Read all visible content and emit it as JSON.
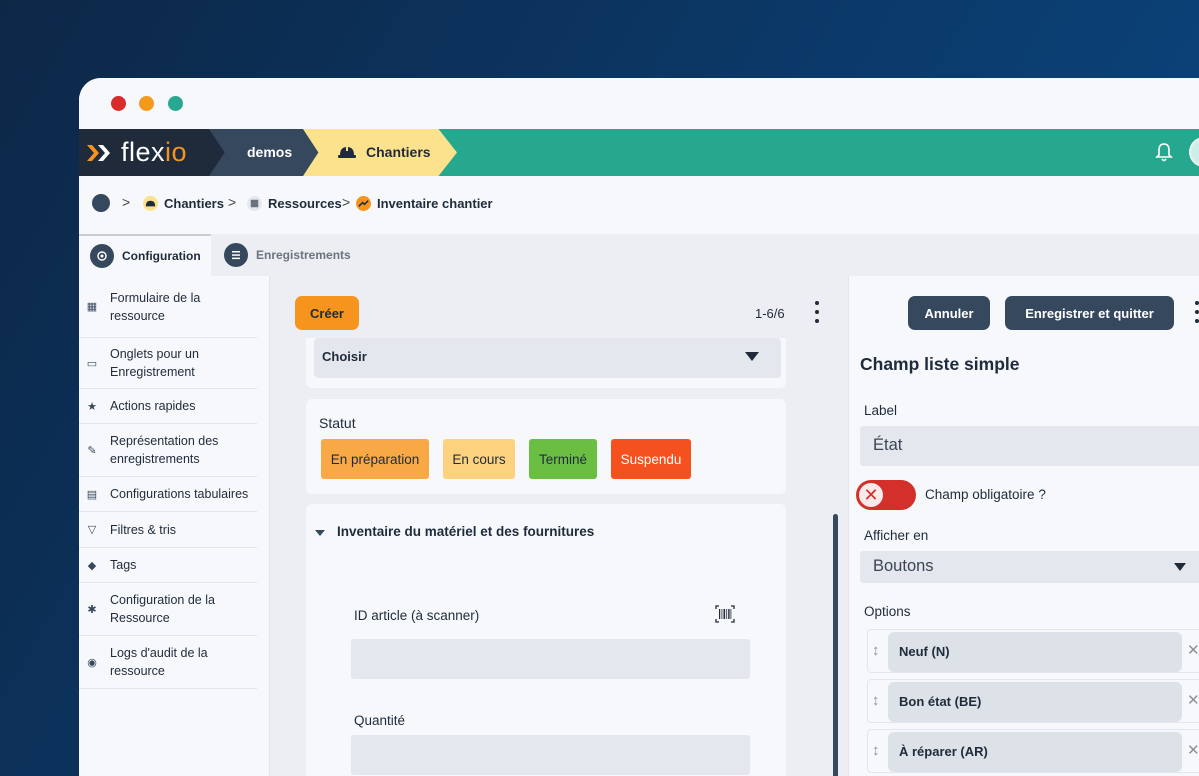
{
  "window_controls": [
    "close",
    "minimize",
    "maximize"
  ],
  "topbar": {
    "logo_text_main": "flex",
    "logo_text_accent": "io",
    "workspace": "demos",
    "app": "Chantiers",
    "colors": {
      "bar": "#25a88e",
      "logo_bg": "#1f2b3b",
      "workspace_bg": "#36485e",
      "app_bg": "#fce28c",
      "accent": "#f7941e"
    }
  },
  "breadcrumb": {
    "items": [
      "Chantiers",
      "Ressources",
      "Inventaire chantier"
    ],
    "separator": ">"
  },
  "tabs": [
    {
      "label": "Configuration",
      "icon": "gear-icon",
      "active": true
    },
    {
      "label": "Enregistrements",
      "icon": "list-icon",
      "active": false
    }
  ],
  "sidebar": {
    "items": [
      {
        "icon": "table-icon",
        "glyph": "▦",
        "label": "Formulaire de la ressource"
      },
      {
        "icon": "folder-icon",
        "glyph": "▭",
        "label": "Onglets pour un Enregistrement"
      },
      {
        "icon": "star-icon",
        "glyph": "★",
        "label": "Actions rapides"
      },
      {
        "icon": "pencil-icon",
        "glyph": "✎",
        "label": "Représentation des enregistrements"
      },
      {
        "icon": "document-icon",
        "glyph": "▤",
        "label": "Configurations tabulaires"
      },
      {
        "icon": "filter-icon",
        "glyph": "▽",
        "label": "Filtres & tris"
      },
      {
        "icon": "tag-icon",
        "glyph": "◆",
        "label": "Tags"
      },
      {
        "icon": "gear-icon",
        "glyph": "✱",
        "label": "Configuration de la Ressource"
      },
      {
        "icon": "eye-icon",
        "glyph": "◉",
        "label": "Logs d'audit de la ressource"
      }
    ]
  },
  "center": {
    "create_label": "Créer",
    "pager": "1-6/6",
    "select_value": "Choisir",
    "statut": {
      "label": "Statut",
      "options": [
        {
          "label": "En préparation",
          "color": "#f8a844"
        },
        {
          "label": "En cours",
          "color": "#fdd27e"
        },
        {
          "label": "Terminé",
          "color": "#6abf43"
        },
        {
          "label": "Suspendu",
          "color": "#f4511e"
        }
      ]
    },
    "section_title": "Inventaire du matériel et des fournitures",
    "fields": [
      {
        "label": "ID article (à scanner)",
        "icon": "barcode-icon"
      },
      {
        "label": "Quantité"
      }
    ]
  },
  "right_panel": {
    "cancel_label": "Annuler",
    "save_label": "Enregistrer et quitter",
    "title": "Champ liste simple",
    "label_field": {
      "label": "Label",
      "value": "État"
    },
    "required_toggle": {
      "label": "Champ obligatoire ?",
      "on": false
    },
    "display_field": {
      "label": "Afficher en",
      "value": "Boutons"
    },
    "options_label": "Options",
    "options": [
      "Neuf (N)",
      "Bon état (BE)",
      "À réparer (AR)"
    ]
  }
}
